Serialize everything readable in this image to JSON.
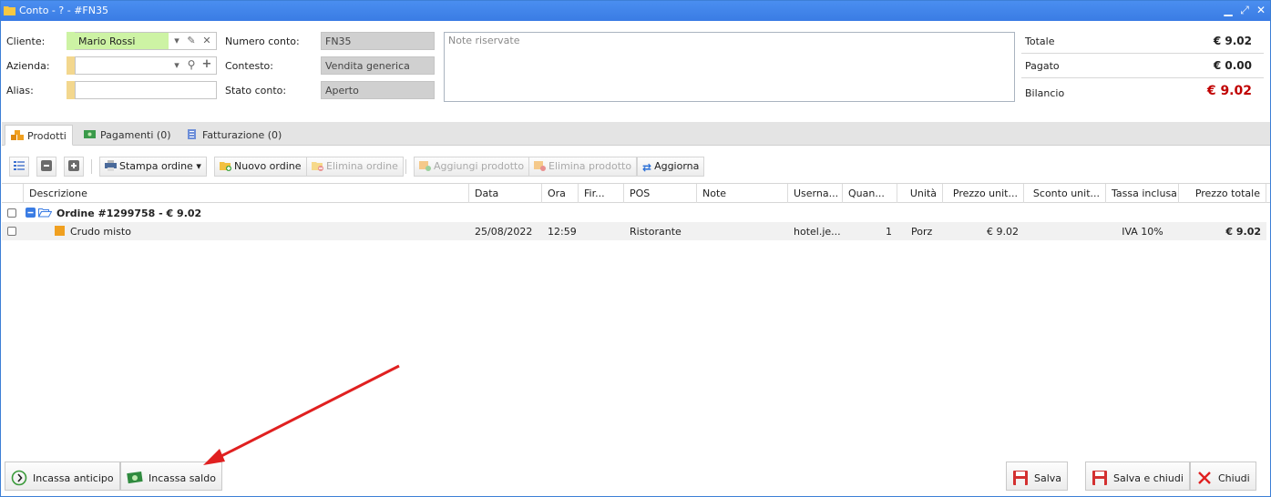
{
  "window": {
    "title": "Conto - ? - #FN35",
    "controls": [
      "minimize-icon",
      "maximize-icon",
      "close-icon"
    ]
  },
  "form": {
    "cliente": {
      "label": "Cliente:",
      "value": "Mario Rossi"
    },
    "azienda": {
      "label": "Azienda:",
      "value": ""
    },
    "alias": {
      "label": "Alias:",
      "value": ""
    },
    "numero_conto": {
      "label": "Numero conto:",
      "value": "FN35"
    },
    "contesto": {
      "label": "Contesto:",
      "value": "Vendita generica"
    },
    "stato_conto": {
      "label": "Stato conto:",
      "value": "Aperto"
    },
    "notes_placeholder": "Note riservate"
  },
  "summary": {
    "totale_label": "Totale",
    "totale_value": "€ 9.02",
    "pagato_label": "Pagato",
    "pagato_value": "€ 0.00",
    "bilancio_label": "Bilancio",
    "bilancio_value": "€ 9.02",
    "bilancio_color": "#c00000"
  },
  "tabs": [
    {
      "label": "Prodotti",
      "icon": "boxes-icon",
      "active": true
    },
    {
      "label": "Pagamenti (0)",
      "icon": "money-icon",
      "active": false
    },
    {
      "label": "Fatturazione (0)",
      "icon": "invoice-icon",
      "active": false
    }
  ],
  "toolbar": {
    "stampa": "Stampa ordine",
    "nuovo": "Nuovo ordine",
    "elimina_ordine": "Elimina ordine",
    "aggiungi": "Aggiungi prodotto",
    "elimina_prodotto": "Elimina prodotto",
    "aggiorna": "Aggiorna"
  },
  "grid": {
    "columns": [
      "Descrizione",
      "Data",
      "Ora",
      "Fir...",
      "POS",
      "Note",
      "Userna...",
      "Quan...",
      "Unità",
      "Prezzo unit...",
      "Sconto unit...",
      "Tassa inclusa",
      "Prezzo totale"
    ],
    "group": {
      "label": "Ordine #1299758 - € 9.02"
    },
    "rows": [
      {
        "descrizione": "Crudo misto",
        "data": "25/08/2022",
        "ora": "12:59",
        "fir": "",
        "pos": "Ristorante",
        "note": "",
        "username": "hotel.je...",
        "quantita": "1",
        "unita": "Porz",
        "prezzo_unit": "€ 9.02",
        "sconto_unit": "",
        "tassa": "IVA 10%",
        "prezzo_totale": "€ 9.02"
      }
    ]
  },
  "footer": {
    "incassa_anticipo": "Incassa anticipo",
    "incassa_saldo": "Incassa saldo",
    "salva": "Salva",
    "salva_chiudi": "Salva e chiudi",
    "chiudi": "Chiudi"
  },
  "colors": {
    "titlebar": "#3a7ce4",
    "accent_green": "#cdf3a4",
    "required": "#f3d78e",
    "arrow": "#e02020"
  }
}
